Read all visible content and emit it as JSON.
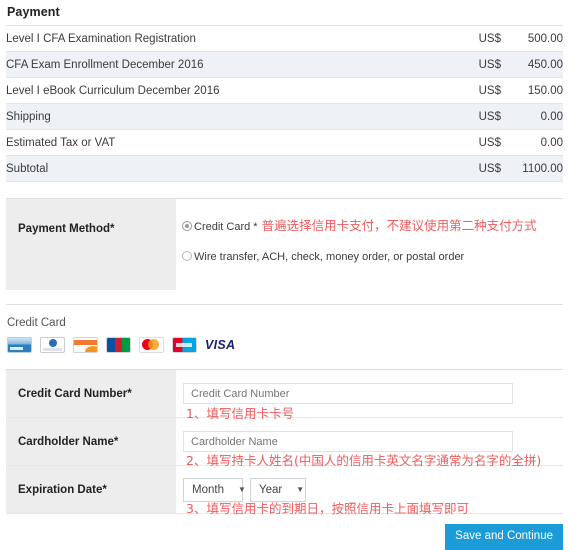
{
  "page_title": "Payment",
  "summary": {
    "rows": [
      {
        "desc": "Level I CFA Examination Registration",
        "currency": "US$",
        "amount": "500.00"
      },
      {
        "desc": "CFA Exam Enrollment December 2016",
        "currency": "US$",
        "amount": "450.00"
      },
      {
        "desc": "Level I eBook Curriculum December 2016",
        "currency": "US$",
        "amount": "150.00"
      },
      {
        "desc": "Shipping",
        "currency": "US$",
        "amount": "0.00"
      },
      {
        "desc": "Estimated Tax or VAT",
        "currency": "US$",
        "amount": "0.00"
      },
      {
        "desc": "Subtotal",
        "currency": "US$",
        "amount": "1100.00"
      }
    ]
  },
  "payment_method": {
    "label": "Payment Method*",
    "option_credit_card": "Credit Card *",
    "option_credit_card_note": "普遍选择信用卡支付，不建议使用第二种支付方式",
    "option_wire": "Wire transfer, ACH, check, money order, or postal order",
    "selected": "credit_card"
  },
  "credit_card_section": {
    "heading": "Credit Card",
    "logos": [
      {
        "name": "generic-card-logo",
        "text": ""
      },
      {
        "name": "diners-club-logo",
        "text": ""
      },
      {
        "name": "discover-logo",
        "text": "DISCOVER"
      },
      {
        "name": "jcb-logo",
        "text": "JCB"
      },
      {
        "name": "mastercard-logo",
        "text": ""
      },
      {
        "name": "amex-logo",
        "text": ""
      },
      {
        "name": "visa-logo",
        "text": "VISA"
      }
    ]
  },
  "form": {
    "card_number": {
      "label": "Credit Card Number*",
      "placeholder": "Credit Card Number",
      "value": ""
    },
    "cardholder_name": {
      "label": "Cardholder Name*",
      "placeholder": "Cardholder Name",
      "value": ""
    },
    "expiration_date": {
      "label": "Expiration Date*",
      "month_value": "Month",
      "year_value": "Year",
      "caret": "▼"
    }
  },
  "annotations": {
    "note1": "1、填写信用卡卡号",
    "note2": "2、填写持卡人姓名(中国人的信用卡英文名字通常为名字的全拼)",
    "note3": "3、填写信用卡的到期日，按照信用卡上面填写即可"
  },
  "actions": {
    "save_label": "Save and Continue"
  },
  "colors": {
    "accent_blue": "#1b9bd8",
    "annotation_red": "#ef5c5c",
    "row_alt": "#eef1f5",
    "label_bg": "#ededed"
  }
}
